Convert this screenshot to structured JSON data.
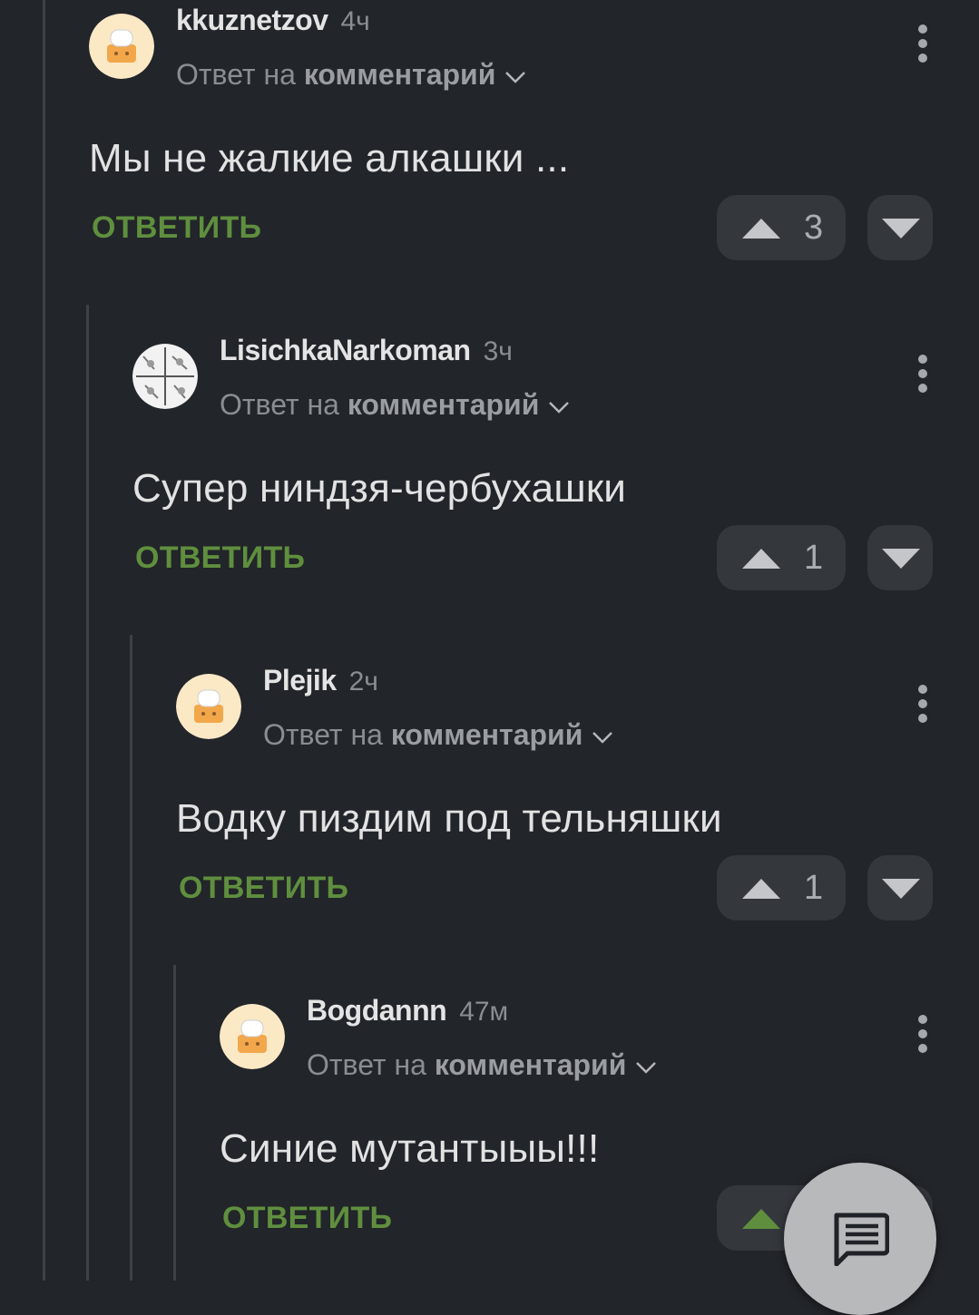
{
  "comments": [
    {
      "author": "kkuznetzov",
      "time": "4ч",
      "reply_prefix": "Ответ на",
      "reply_link": "комментарий",
      "text": "Мы не жалкие алкашки ...",
      "reply_label": "ОТВЕТИТЬ",
      "upvotes": "3",
      "avatar": "default-avatar"
    },
    {
      "author": "LisichkaNarkoman",
      "time": "3ч",
      "reply_prefix": "Ответ на",
      "reply_link": "комментарий",
      "text": "Супер ниндзя-чербухашки",
      "reply_label": "ОТВЕТИТЬ",
      "upvotes": "1",
      "avatar": "comic-avatar"
    },
    {
      "author": "Plejik",
      "time": "2ч",
      "reply_prefix": "Ответ на",
      "reply_link": "комментарий",
      "text": "Водку пиздим под тельняшки",
      "reply_label": "ОТВЕТИТЬ",
      "upvotes": "1",
      "avatar": "default-avatar"
    },
    {
      "author": "Bogdannn",
      "time": "47м",
      "reply_prefix": "Ответ на",
      "reply_link": "комментарий",
      "text": "Синие мутантыыы!!!",
      "reply_label": "ОТВЕТИТЬ",
      "upvotes": "",
      "avatar": "default-avatar"
    }
  ],
  "colors": {
    "background": "#222529",
    "accent_green": "#5f8f3e",
    "upvote_active": "#5f8f3e",
    "button_bg": "#34383d"
  },
  "icons": {
    "menu": "more-vert-icon",
    "chevron": "chevron-down-icon",
    "upvote": "arrow-up-icon",
    "downvote": "arrow-down-icon",
    "fab": "comment-icon"
  }
}
